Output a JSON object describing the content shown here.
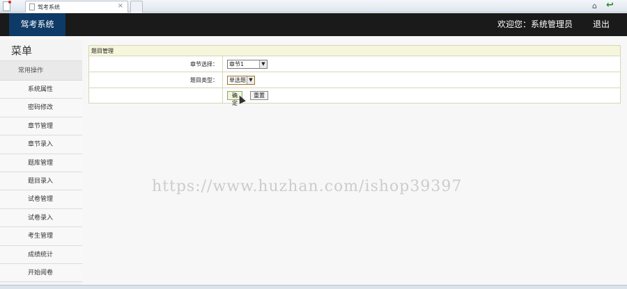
{
  "browser": {
    "tab_title": "驾考系统",
    "tab_close": "×",
    "home_icon": "⌂",
    "back_icon": "↩"
  },
  "header": {
    "brand": "驾考系统",
    "welcome": "欢迎您：系统管理员",
    "logout": "退出"
  },
  "sidebar": {
    "title": "菜单",
    "group": "常用操作",
    "items": [
      {
        "label": "系统属性"
      },
      {
        "label": "密码修改"
      },
      {
        "label": "章节管理"
      },
      {
        "label": "章节录入"
      },
      {
        "label": "题库管理"
      },
      {
        "label": "题目录入"
      },
      {
        "label": "试卷管理"
      },
      {
        "label": "试卷录入"
      },
      {
        "label": "考生管理"
      },
      {
        "label": "成绩统计"
      },
      {
        "label": "开始阅卷"
      }
    ]
  },
  "panel": {
    "title": "题目管理",
    "chapter_label": "章节选择：",
    "chapter_value": "章节1",
    "type_label": "题目类型：",
    "type_value": "单选题",
    "confirm": "确定",
    "reset": "重置"
  },
  "watermark": "https://www.huzhan.com/ishop39397",
  "colors": {
    "header_bg": "#1a1a1a",
    "brand_bg": "#0d3a66",
    "panel_header_bg": "#f6f6dc"
  }
}
